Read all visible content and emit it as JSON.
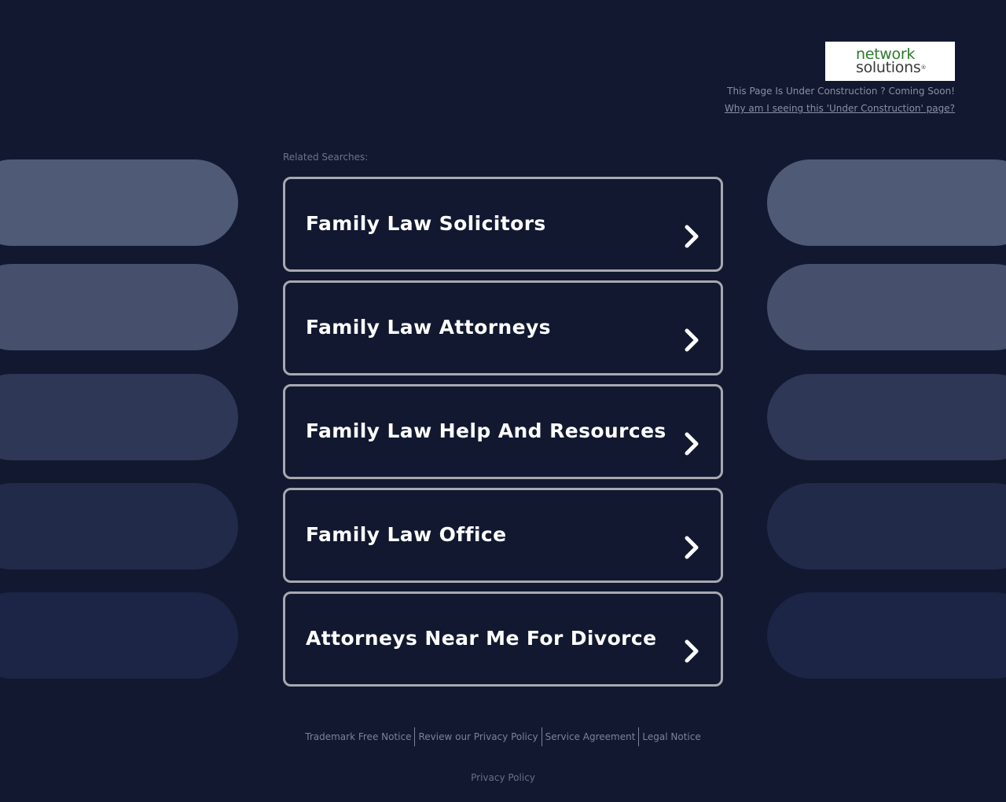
{
  "logo": {
    "line1": "network",
    "line2": "solutions",
    "reg": "®"
  },
  "notice": {
    "text": "This Page Is Under Construction ? Coming Soon!",
    "link": "Why am I seeing this 'Under Construction' page?"
  },
  "related": {
    "label": "Related Searches:",
    "items": [
      {
        "label": "Family Law Solicitors"
      },
      {
        "label": "Family Law Attorneys"
      },
      {
        "label": "Family Law Help And Resources"
      },
      {
        "label": "Family Law Office"
      },
      {
        "label": "Attorneys Near Me For Divorce"
      }
    ]
  },
  "footer": {
    "links": [
      "Trademark Free Notice",
      "Review our Privacy Policy",
      "Service Agreement",
      "Legal Notice"
    ],
    "privacy": "Privacy Policy"
  },
  "colors": {
    "background": "#111830",
    "pills": [
      "#4f5a76",
      "#464f6b",
      "#2e3756",
      "#222a4a",
      "#1c2545"
    ],
    "card_border": "#a7a9b0",
    "logo_green": "#2a7a2a"
  },
  "icons": {
    "card_arrow": "chevron-right-icon"
  }
}
